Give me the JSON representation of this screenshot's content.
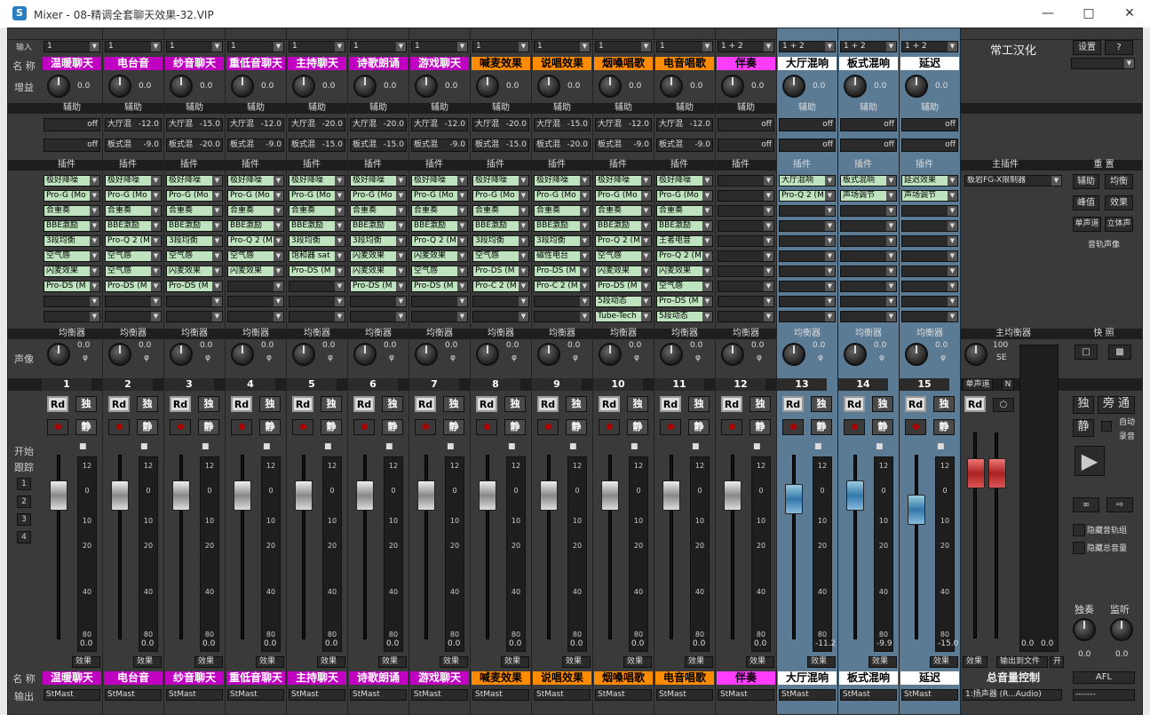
{
  "window": {
    "title": "Mixer - 08-精调全套聊天效果-32.VIP",
    "icon": "S"
  },
  "left_labels": {
    "input": "输入",
    "name": "名 称",
    "gain": "增益",
    "pan": "声像",
    "start": "开始",
    "follow": "跟踪",
    "name_bottom": "名 称",
    "output": "输出",
    "buttons": [
      "1",
      "2",
      "3",
      "4"
    ]
  },
  "section_labels": {
    "aux": "辅助",
    "plugin": "插件",
    "eq": "均衡器",
    "fx": "效果"
  },
  "channels": [
    {
      "num": "1",
      "input": "1",
      "name": "温暖聊天",
      "name_color": "#c000c0",
      "name_text": "#ffffff",
      "gain": "0.0",
      "send1": "off",
      "send1_active": false,
      "send2": "off",
      "send2_active": false,
      "send1_label": "",
      "send2_label": "",
      "plugins": [
        "极好降噪",
        "Pro-G (Mo",
        "合重奏",
        "BBE激励",
        "3段均衡",
        "空气感",
        "闪麦效果",
        "Pro-DS (M",
        "",
        ""
      ],
      "pan": "0.0",
      "fader_val": "0.0",
      "fader": 0,
      "blue": false,
      "output": "StMast"
    },
    {
      "num": "2",
      "input": "1",
      "name": "电台音",
      "name_color": "#c000c0",
      "name_text": "#ffffff",
      "gain": "0.0",
      "send1_label": "大厅混",
      "send1": "-12.0",
      "send1_active": true,
      "send2_label": "板式混",
      "send2": "-9.0",
      "send2_active": true,
      "plugins": [
        "极好降噪",
        "Pro-G (Mo",
        "合重奏",
        "BBE激励",
        "Pro-Q 2 (M",
        "空气感",
        "空气感",
        "Pro-DS (M",
        "",
        ""
      ],
      "pan": "0.0",
      "fader_val": "0.0",
      "fader": 0,
      "blue": false,
      "output": "StMast"
    },
    {
      "num": "3",
      "input": "1",
      "name": "纱音聊天",
      "name_color": "#c000c0",
      "name_text": "#ffffff",
      "gain": "0.0",
      "send1_label": "大厅混",
      "send1": "-15.0",
      "send1_active": true,
      "send2_label": "板式混",
      "send2": "-20.0",
      "send2_active": true,
      "plugins": [
        "极好降噪",
        "Pro-G (Mo",
        "合重奏",
        "BBE激励",
        "3段均衡",
        "空气感",
        "闪麦效果",
        "Pro-DS (M",
        "",
        ""
      ],
      "pan": "0.0",
      "fader_val": "0.0",
      "fader": 0,
      "blue": false,
      "output": "StMast"
    },
    {
      "num": "4",
      "input": "1",
      "name": "重低音聊天",
      "name_color": "#c000c0",
      "name_text": "#ffffff",
      "gain": "0.0",
      "send1_label": "大厅混",
      "send1": "-12.0",
      "send1_active": true,
      "send2_label": "板式混",
      "send2": "-9.0",
      "send2_active": true,
      "plugins": [
        "极好降噪",
        "Pro-G (Mo",
        "合重奏",
        "BBE激励",
        "Pro-Q 2 (M",
        "空气感",
        "闪麦效果",
        "",
        "",
        ""
      ],
      "pan": "0.0",
      "fader_val": "0.0",
      "fader": 0,
      "blue": false,
      "output": "StMast"
    },
    {
      "num": "5",
      "input": "1",
      "name": "主持聊天",
      "name_color": "#c000c0",
      "name_text": "#ffffff",
      "gain": "0.0",
      "send1_label": "大厅混",
      "send1": "-20.0",
      "send1_active": true,
      "send2_label": "板式混",
      "send2": "-15.0",
      "send2_active": true,
      "plugins": [
        "极好降噪",
        "Pro-G (Mo",
        "合重奏",
        "BBE激励",
        "3段均衡",
        "饱和器 sat",
        "Pro-DS (M",
        "",
        "",
        ""
      ],
      "pan": "0.0",
      "fader_val": "0.0",
      "fader": 0,
      "blue": false,
      "output": "StMast"
    },
    {
      "num": "6",
      "input": "1",
      "name": "诗歌朗诵",
      "name_color": "#c000c0",
      "name_text": "#ffffff",
      "gain": "0.0",
      "send1_label": "大厅混",
      "send1": "-20.0",
      "send1_active": true,
      "send2_label": "板式混",
      "send2": "-15.0",
      "send2_active": true,
      "plugins": [
        "极好降噪",
        "Pro-G (Mo",
        "合重奏",
        "BBE激励",
        "3段均衡",
        "闪麦效果",
        "闪麦效果",
        "Pro-DS (M",
        "",
        ""
      ],
      "pan": "0.0",
      "fader_val": "0.0",
      "fader": 0,
      "blue": false,
      "output": "StMast"
    },
    {
      "num": "7",
      "input": "1",
      "name": "游戏聊天",
      "name_color": "#c000c0",
      "name_text": "#ffffff",
      "gain": "0.0",
      "send1_label": "大厅混",
      "send1": "-12.0",
      "send1_active": true,
      "send2_label": "板式混",
      "send2": "-9.0",
      "send2_active": true,
      "plugins": [
        "极好降噪",
        "Pro-G (Mo",
        "合重奏",
        "BBE激励",
        "Pro-Q 2 (M",
        "闪麦效果",
        "空气感",
        "Pro-DS (M",
        "",
        ""
      ],
      "pan": "0.0",
      "fader_val": "0.0",
      "fader": 0,
      "blue": false,
      "output": "StMast"
    },
    {
      "num": "8",
      "input": "1",
      "name": "喊麦效果",
      "name_color": "#ff8c00",
      "name_text": "#000000",
      "gain": "0.0",
      "send1_label": "大厅混",
      "send1": "-20.0",
      "send1_active": true,
      "send2_label": "板式混",
      "send2": "-15.0",
      "send2_active": true,
      "plugins": [
        "极好降噪",
        "Pro-G (Mo",
        "合重奏",
        "BBE激励",
        "3段均衡",
        "空气感",
        "Pro-DS (M",
        "Pro-C 2 (M",
        "",
        ""
      ],
      "pan": "0.0",
      "fader_val": "0.0",
      "fader": 0,
      "blue": false,
      "output": "StMast"
    },
    {
      "num": "9",
      "input": "1",
      "name": "说唱效果",
      "name_color": "#ff8c00",
      "name_text": "#000000",
      "gain": "0.0",
      "send1_label": "大厅混",
      "send1": "-15.0",
      "send1_active": true,
      "send2_label": "板式混",
      "send2": "-20.0",
      "send2_active": true,
      "plugins": [
        "极好降噪",
        "Pro-G (Mo",
        "合重奏",
        "BBE激励",
        "3段均衡",
        "磁性电台",
        "Pro-DS (M",
        "Pro-C 2 (M",
        "",
        ""
      ],
      "pan": "0.0",
      "fader_val": "0.0",
      "fader": 0,
      "blue": false,
      "output": "StMast"
    },
    {
      "num": "10",
      "input": "1",
      "name": "烟嗓唱歌",
      "name_color": "#ff8c00",
      "name_text": "#000000",
      "gain": "0.0",
      "send1_label": "大厅混",
      "send1": "-12.0",
      "send1_active": true,
      "send2_label": "板式混",
      "send2": "-9.0",
      "send2_active": true,
      "plugins": [
        "极好降噪",
        "Pro-G (Mo",
        "合重奏",
        "BBE激励",
        "Pro-Q 2 (M",
        "空气感",
        "闪麦效果",
        "Pro-DS (M",
        "5段动态",
        "Tube-Tech"
      ],
      "pan": "0.0",
      "fader_val": "0.0",
      "fader": 0,
      "blue": false,
      "output": "StMast"
    },
    {
      "num": "11",
      "input": "1",
      "name": "电音唱歌",
      "name_color": "#ff8c00",
      "name_text": "#000000",
      "gain": "0.0",
      "send1_label": "大厅混",
      "send1": "-12.0",
      "send1_active": true,
      "send2_label": "板式混",
      "send2": "-9.0",
      "send2_active": true,
      "plugins": [
        "极好降噪",
        "Pro-G (Mo",
        "合重奏",
        "BBE激励",
        "王者电音",
        "Pro-Q 2 (M",
        "闪麦效果",
        "空气感",
        "Pro-DS (M",
        "5段动态"
      ],
      "pan": "0.0",
      "fader_val": "0.0",
      "fader": 0,
      "blue": false,
      "output": "StMast"
    },
    {
      "num": "12",
      "input": "1 + 2",
      "name": "伴奏",
      "name_color": "#ff3cff",
      "name_text": "#000000",
      "gain": "0.0",
      "send1_label": "",
      "send1": "off",
      "send1_active": false,
      "send2_label": "",
      "send2": "off",
      "send2_active": false,
      "plugins": [
        "",
        "",
        "",
        "",
        "",
        "",
        "",
        "",
        "",
        ""
      ],
      "pan": "0.0",
      "fader_val": "0.0",
      "fader": 0,
      "blue": false,
      "output": "StMast"
    },
    {
      "num": "13",
      "input": "1 + 2",
      "name": "大厅混响",
      "name_color": "#ffffff",
      "name_text": "#000000",
      "gain": "0.0",
      "send1_label": "",
      "send1": "off",
      "send1_active": false,
      "send2_label": "",
      "send2": "off",
      "send2_active": false,
      "plugins": [
        "大厅混响",
        "Pro-Q 2 (M",
        "",
        "",
        "",
        "",
        "",
        "",
        "",
        ""
      ],
      "pan": "0.0",
      "fader_val": "-11.2",
      "fader": 1,
      "blue": true,
      "output": "StMast"
    },
    {
      "num": "14",
      "input": "1 + 2",
      "name": "板式混响",
      "name_color": "#ffffff",
      "name_text": "#000000",
      "gain": "0.0",
      "send1_label": "",
      "send1": "off",
      "send1_active": false,
      "send2_label": "",
      "send2": "off",
      "send2_active": false,
      "plugins": [
        "板式混响",
        "声场调节",
        "",
        "",
        "",
        "",
        "",
        "",
        "",
        ""
      ],
      "pan": "0.0",
      "fader_val": "-9.9",
      "fader": 2,
      "blue": true,
      "output": "StMast"
    },
    {
      "num": "15",
      "input": "1 + 2",
      "name": "延迟",
      "name_color": "#ffffff",
      "name_text": "#000000",
      "gain": "0.0",
      "send1_label": "",
      "send1": "off",
      "send1_active": false,
      "send2_label": "",
      "send2": "off",
      "send2_active": false,
      "plugins": [
        "延迟效果",
        "声场调节",
        "",
        "",
        "",
        "",
        "",
        "",
        "",
        ""
      ],
      "pan": "0.0",
      "fader_val": "-15.0",
      "fader": 3,
      "blue": true,
      "output": "StMast"
    }
  ],
  "master": {
    "header": "常工汉化",
    "plugins_label": "主插件",
    "plugin1": "板岩FG-X限制器",
    "eq_label": "主均衡器",
    "pan_val": "100",
    "pan_mode": "SE",
    "mono": "单声道",
    "n": "N",
    "rd": "Rd",
    "fx": "效果",
    "output_file": "输出到文件",
    "on": "开",
    "name": "总音量控制",
    "output": "1:扬声器 (R...Audio)",
    "meter_bottom": [
      "0.0",
      "0.0"
    ]
  },
  "control_panel": {
    "settings": "设置",
    "help": "?",
    "reset": "重 置",
    "aux": "辅助",
    "balance": "均衡",
    "peak": "峰值",
    "effects": "效果",
    "mono": "单声道",
    "stereo": "立体声",
    "track_pan": "音轨声像",
    "snapshot": "快 照",
    "solo": "独",
    "bypass": "旁 通",
    "mute": "静",
    "auto": "自动",
    "record": "录音",
    "hide_tracks": "隐藏音轨组",
    "hide_master": "隐藏总音量",
    "solo_label": "独奏",
    "monitor_label": "监听",
    "solo_val": "0.0",
    "monitor_val": "0.0",
    "afl": "AFL",
    "out_sel": "-------"
  },
  "strip_labels": {
    "rd": "Rd",
    "solo": "独",
    "mute": "静",
    "fx": "效果",
    "eq": "均衡器",
    "aux": "辅助",
    "plugin": "插件"
  },
  "meter_scale": [
    "12",
    "0",
    "10",
    "20",
    "40",
    "80"
  ],
  "colors": {
    "bg": "#3a3a3a",
    "header": "#1e1e1e",
    "plugin": "#bfe3bf",
    "name_purple": "#c000c0",
    "name_orange": "#ff8c00",
    "name_pink": "#ff3cff"
  }
}
